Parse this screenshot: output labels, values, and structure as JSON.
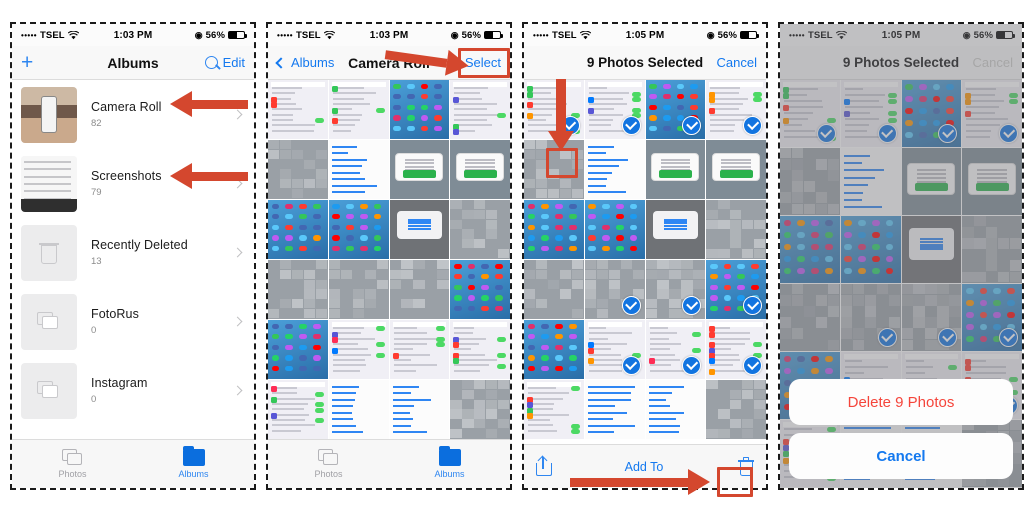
{
  "meta": {
    "accent_blue": "#1479ef",
    "annotation_red": "#d4472e",
    "destructive_red": "#f5453b"
  },
  "panels": [
    {
      "id": "albums-list",
      "status": {
        "dots": "•••••",
        "carrier": "TSEL",
        "wifi": "wifi-icon",
        "time": "1:03 PM",
        "location": "location-icon",
        "battery": "56%"
      },
      "nav": {
        "left_icon": "plus-icon",
        "title": "Albums",
        "right_icon": "search-icon",
        "right_label": "Edit"
      },
      "albums": [
        {
          "name": "Camera Roll",
          "count": "82",
          "thumb": "photo"
        },
        {
          "name": "Screenshots",
          "count": "79",
          "thumb": "screenshot"
        },
        {
          "name": "Recently Deleted",
          "count": "13",
          "thumb": "trash"
        },
        {
          "name": "FotoRus",
          "count": "0",
          "thumb": "stack"
        },
        {
          "name": "Instagram",
          "count": "0",
          "thumb": "stack"
        }
      ],
      "tabs": [
        {
          "label": "Photos",
          "active": false
        },
        {
          "label": "Albums",
          "active": true
        }
      ]
    },
    {
      "id": "camera-roll",
      "status": {
        "dots": "•••••",
        "carrier": "TSEL",
        "wifi": "wifi-icon",
        "time": "1:03 PM",
        "location": "location-icon",
        "battery": "56%"
      },
      "nav": {
        "back_label": "Albums",
        "title": "Camera Roll",
        "right_label": "Select"
      },
      "tabs": [
        {
          "label": "Photos",
          "active": false
        },
        {
          "label": "Albums",
          "active": true
        }
      ]
    },
    {
      "id": "selection-mode",
      "status": {
        "dots": "•••••",
        "carrier": "TSEL",
        "wifi": "wifi-icon",
        "time": "1:05 PM",
        "location": "location-icon",
        "battery": "56%"
      },
      "nav": {
        "title": "9 Photos Selected",
        "right_label": "Cancel"
      },
      "toolbar": {
        "share": "share-icon",
        "add_to": "Add To",
        "delete": "trash-icon"
      }
    },
    {
      "id": "delete-confirm",
      "status": {
        "dots": "•••••",
        "carrier": "TSEL",
        "wifi": "wifi-icon",
        "time": "1:05 PM",
        "location": "location-icon",
        "battery": "56%"
      },
      "nav": {
        "title": "9 Photos Selected",
        "right_label": "Cancel"
      },
      "action_sheet": {
        "destructive": "Delete 9 Photos",
        "cancel": "Cancel"
      }
    }
  ],
  "annotations": {
    "arrow_camera_roll": "arrow-pointing-at-camera-roll",
    "arrow_screenshots": "arrow-pointing-at-screenshots",
    "arrow_select": "arrow-pointing-at-select",
    "arrow_checkmark": "arrow-pointing-down-at-checkmark",
    "arrow_trash": "arrow-pointing-at-trash",
    "box_select": "highlight-box-select",
    "box_checkmark": "highlight-box-checkmark",
    "box_trash": "highlight-box-trash"
  }
}
